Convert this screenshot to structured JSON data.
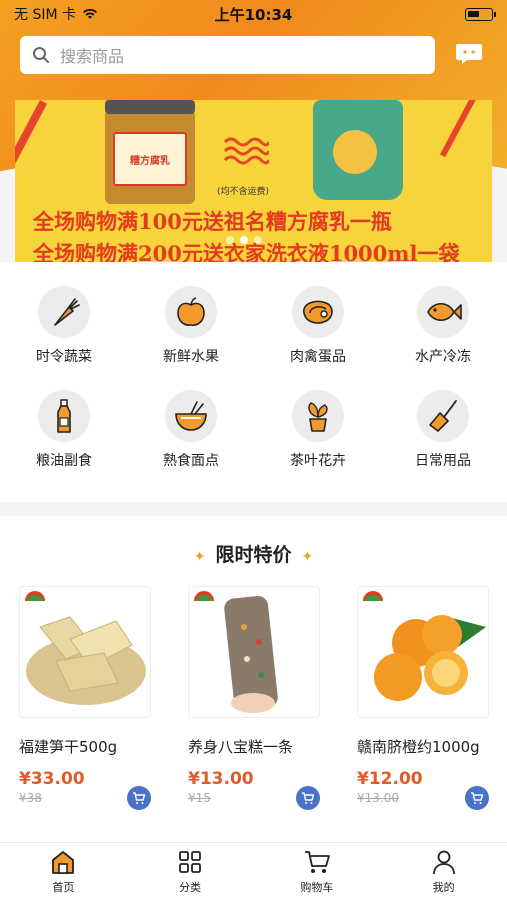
{
  "status_bar": {
    "carrier": "无 SIM 卡",
    "time": "上午10:34"
  },
  "search": {
    "placeholder": "搜索商品"
  },
  "banner": {
    "jar_label": "糟方腐乳",
    "note": "(均不含运费)",
    "promo_line1": "全场购物满100元送祖名糟方腐乳一瓶",
    "promo_line2": "全场购物满200元送衣家洗衣液1000ml一袋",
    "dots": 3,
    "active_dot": 1
  },
  "categories": [
    {
      "label": "时令蔬菜",
      "icon": "carrot-icon"
    },
    {
      "label": "新鲜水果",
      "icon": "apple-icon"
    },
    {
      "label": "肉禽蛋品",
      "icon": "meat-icon"
    },
    {
      "label": "水产冷冻",
      "icon": "fish-icon"
    },
    {
      "label": "粮油副食",
      "icon": "oil-bottle-icon"
    },
    {
      "label": "熟食面点",
      "icon": "noodle-bowl-icon"
    },
    {
      "label": "茶叶花卉",
      "icon": "potted-plant-icon"
    },
    {
      "label": "日常用品",
      "icon": "broom-icon"
    }
  ],
  "flash_sale": {
    "title": "限时特价",
    "products": [
      {
        "name": "福建笋干500g",
        "price": "¥33.00",
        "old_price": "¥38",
        "image": "bamboo-shoots-image"
      },
      {
        "name": "养身八宝糕一条",
        "price": "¥13.00",
        "old_price": "¥15",
        "image": "rice-cake-image"
      },
      {
        "name": "赣南脐橙约1000g",
        "price": "¥12.00",
        "old_price": "¥13.00",
        "image": "oranges-image"
      }
    ]
  },
  "tabbar": [
    {
      "label": "首页",
      "icon": "home-icon",
      "active": true
    },
    {
      "label": "分类",
      "icon": "grid-icon"
    },
    {
      "label": "购物车",
      "icon": "cart-icon"
    },
    {
      "label": "我的",
      "icon": "user-icon"
    }
  ],
  "colors": {
    "accent": "#f5a020",
    "price": "#e05a2b",
    "cart_button": "#4a72c8"
  }
}
